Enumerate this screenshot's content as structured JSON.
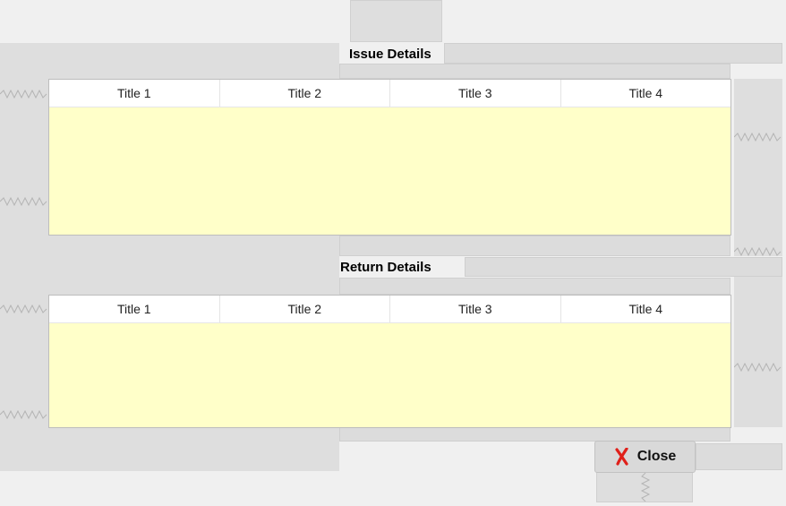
{
  "sections": {
    "issue": {
      "label": "Issue Details",
      "columns": [
        "Title 1",
        "Title 2",
        "Title 3",
        "Title 4"
      ]
    },
    "return": {
      "label": "Return Details",
      "columns": [
        "Title 1",
        "Title 2",
        "Title 3",
        "Title 4"
      ]
    }
  },
  "footer": {
    "close_label": "Close",
    "close_icon": "x-icon"
  },
  "colors": {
    "table_body": "#ffffc9",
    "close_icon": "#e0201a"
  }
}
